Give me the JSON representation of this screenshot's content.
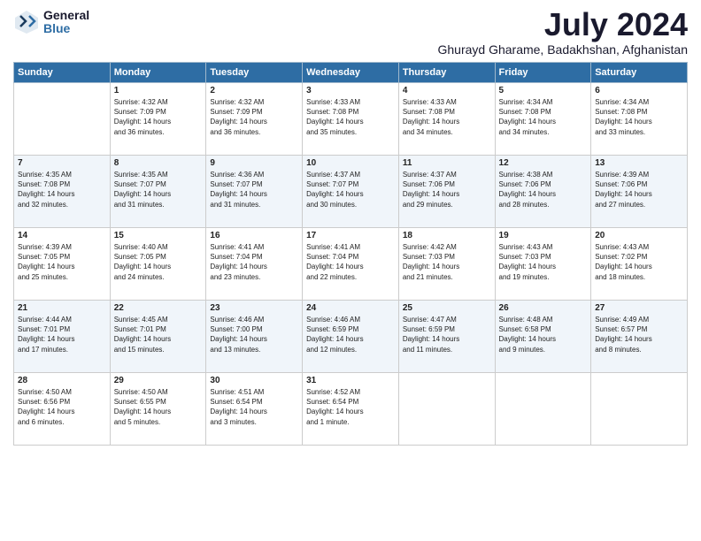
{
  "header": {
    "logo_general": "General",
    "logo_blue": "Blue",
    "month_year": "July 2024",
    "location": "Ghurayd Gharame, Badakhshan, Afghanistan"
  },
  "days_of_week": [
    "Sunday",
    "Monday",
    "Tuesday",
    "Wednesday",
    "Thursday",
    "Friday",
    "Saturday"
  ],
  "weeks": [
    [
      {
        "day": "",
        "content": ""
      },
      {
        "day": "1",
        "content": "Sunrise: 4:32 AM\nSunset: 7:09 PM\nDaylight: 14 hours\nand 36 minutes."
      },
      {
        "day": "2",
        "content": "Sunrise: 4:32 AM\nSunset: 7:09 PM\nDaylight: 14 hours\nand 36 minutes."
      },
      {
        "day": "3",
        "content": "Sunrise: 4:33 AM\nSunset: 7:08 PM\nDaylight: 14 hours\nand 35 minutes."
      },
      {
        "day": "4",
        "content": "Sunrise: 4:33 AM\nSunset: 7:08 PM\nDaylight: 14 hours\nand 34 minutes."
      },
      {
        "day": "5",
        "content": "Sunrise: 4:34 AM\nSunset: 7:08 PM\nDaylight: 14 hours\nand 34 minutes."
      },
      {
        "day": "6",
        "content": "Sunrise: 4:34 AM\nSunset: 7:08 PM\nDaylight: 14 hours\nand 33 minutes."
      }
    ],
    [
      {
        "day": "7",
        "content": "Sunrise: 4:35 AM\nSunset: 7:08 PM\nDaylight: 14 hours\nand 32 minutes."
      },
      {
        "day": "8",
        "content": "Sunrise: 4:35 AM\nSunset: 7:07 PM\nDaylight: 14 hours\nand 31 minutes."
      },
      {
        "day": "9",
        "content": "Sunrise: 4:36 AM\nSunset: 7:07 PM\nDaylight: 14 hours\nand 31 minutes."
      },
      {
        "day": "10",
        "content": "Sunrise: 4:37 AM\nSunset: 7:07 PM\nDaylight: 14 hours\nand 30 minutes."
      },
      {
        "day": "11",
        "content": "Sunrise: 4:37 AM\nSunset: 7:06 PM\nDaylight: 14 hours\nand 29 minutes."
      },
      {
        "day": "12",
        "content": "Sunrise: 4:38 AM\nSunset: 7:06 PM\nDaylight: 14 hours\nand 28 minutes."
      },
      {
        "day": "13",
        "content": "Sunrise: 4:39 AM\nSunset: 7:06 PM\nDaylight: 14 hours\nand 27 minutes."
      }
    ],
    [
      {
        "day": "14",
        "content": "Sunrise: 4:39 AM\nSunset: 7:05 PM\nDaylight: 14 hours\nand 25 minutes."
      },
      {
        "day": "15",
        "content": "Sunrise: 4:40 AM\nSunset: 7:05 PM\nDaylight: 14 hours\nand 24 minutes."
      },
      {
        "day": "16",
        "content": "Sunrise: 4:41 AM\nSunset: 7:04 PM\nDaylight: 14 hours\nand 23 minutes."
      },
      {
        "day": "17",
        "content": "Sunrise: 4:41 AM\nSunset: 7:04 PM\nDaylight: 14 hours\nand 22 minutes."
      },
      {
        "day": "18",
        "content": "Sunrise: 4:42 AM\nSunset: 7:03 PM\nDaylight: 14 hours\nand 21 minutes."
      },
      {
        "day": "19",
        "content": "Sunrise: 4:43 AM\nSunset: 7:03 PM\nDaylight: 14 hours\nand 19 minutes."
      },
      {
        "day": "20",
        "content": "Sunrise: 4:43 AM\nSunset: 7:02 PM\nDaylight: 14 hours\nand 18 minutes."
      }
    ],
    [
      {
        "day": "21",
        "content": "Sunrise: 4:44 AM\nSunset: 7:01 PM\nDaylight: 14 hours\nand 17 minutes."
      },
      {
        "day": "22",
        "content": "Sunrise: 4:45 AM\nSunset: 7:01 PM\nDaylight: 14 hours\nand 15 minutes."
      },
      {
        "day": "23",
        "content": "Sunrise: 4:46 AM\nSunset: 7:00 PM\nDaylight: 14 hours\nand 13 minutes."
      },
      {
        "day": "24",
        "content": "Sunrise: 4:46 AM\nSunset: 6:59 PM\nDaylight: 14 hours\nand 12 minutes."
      },
      {
        "day": "25",
        "content": "Sunrise: 4:47 AM\nSunset: 6:59 PM\nDaylight: 14 hours\nand 11 minutes."
      },
      {
        "day": "26",
        "content": "Sunrise: 4:48 AM\nSunset: 6:58 PM\nDaylight: 14 hours\nand 9 minutes."
      },
      {
        "day": "27",
        "content": "Sunrise: 4:49 AM\nSunset: 6:57 PM\nDaylight: 14 hours\nand 8 minutes."
      }
    ],
    [
      {
        "day": "28",
        "content": "Sunrise: 4:50 AM\nSunset: 6:56 PM\nDaylight: 14 hours\nand 6 minutes."
      },
      {
        "day": "29",
        "content": "Sunrise: 4:50 AM\nSunset: 6:55 PM\nDaylight: 14 hours\nand 5 minutes."
      },
      {
        "day": "30",
        "content": "Sunrise: 4:51 AM\nSunset: 6:54 PM\nDaylight: 14 hours\nand 3 minutes."
      },
      {
        "day": "31",
        "content": "Sunrise: 4:52 AM\nSunset: 6:54 PM\nDaylight: 14 hours\nand 1 minute."
      },
      {
        "day": "",
        "content": ""
      },
      {
        "day": "",
        "content": ""
      },
      {
        "day": "",
        "content": ""
      }
    ]
  ]
}
